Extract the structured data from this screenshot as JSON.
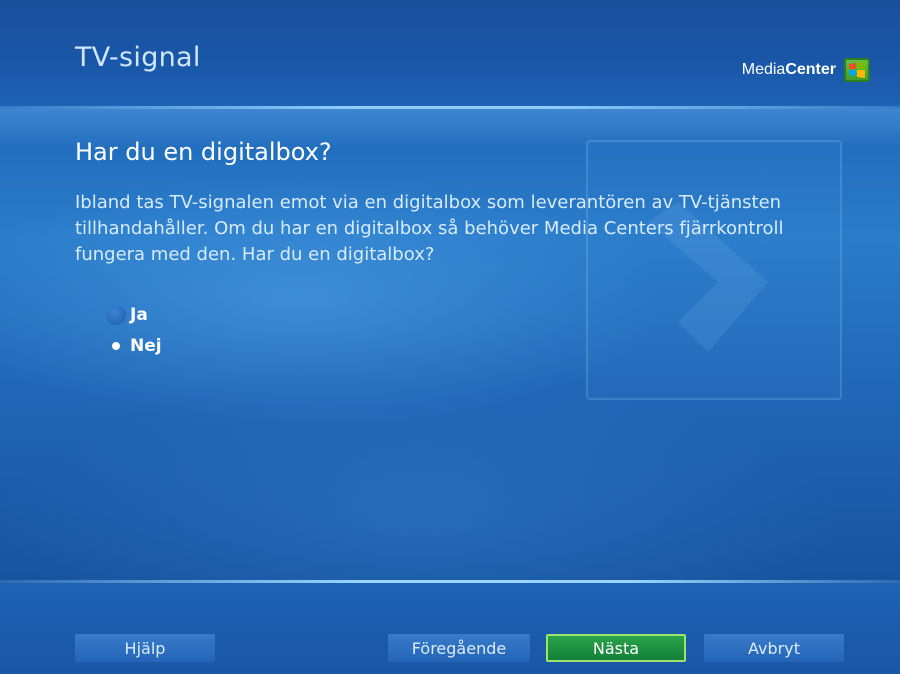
{
  "header": {
    "title": "TV-signal",
    "brand_light": "Media",
    "brand_bold": "Center"
  },
  "main": {
    "heading": "Har du en digitalbox?",
    "description": "Ibland tas TV-signalen emot via en digitalbox som leverantören av TV-tjänsten tillhandahåller. Om du har en digitalbox så behöver Media Centers fjärrkontroll fungera med den. Har du en digitalbox?",
    "options": [
      {
        "label": "Ja",
        "selected": false
      },
      {
        "label": "Nej",
        "selected": true
      }
    ]
  },
  "footer": {
    "help_label": "Hjälp",
    "prev_label": "Föregående",
    "next_label": "Nästa",
    "cancel_label": "Avbryt"
  },
  "colors": {
    "background": "#1e67b8",
    "accent_focus": "#14803a",
    "text": "#ffffff"
  }
}
